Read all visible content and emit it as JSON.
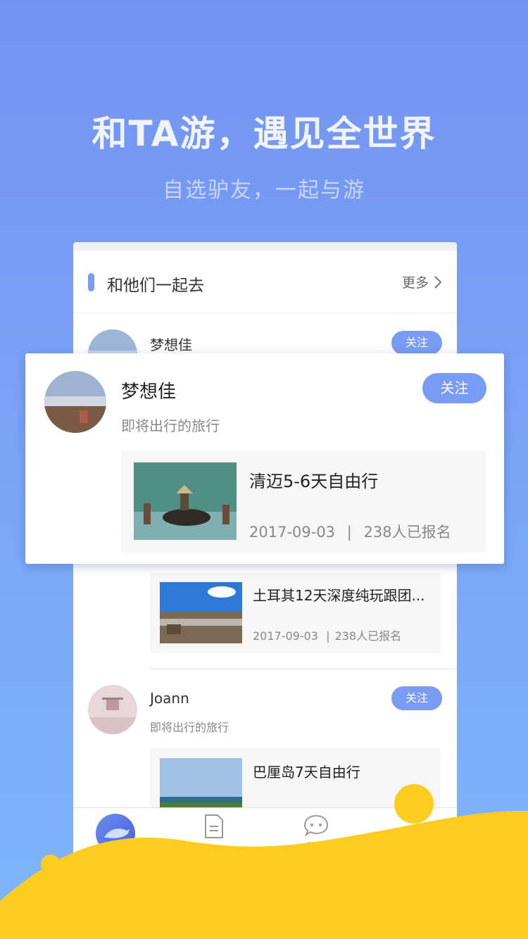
{
  "hero": {
    "title": "和TA游，遇见全世界",
    "subtitle": "自选驴友，一起与游"
  },
  "section": {
    "title": "和他们一起去",
    "more_label": "更多"
  },
  "list": {
    "item1": {
      "name": "梦想佳",
      "follow_label": "关注",
      "trip": {
        "title": "土耳其12天深度纯玩跟团...",
        "date": "2017-09-03",
        "separator": "|",
        "signups": "238人已报名"
      }
    },
    "item2": {
      "name": "Joann",
      "subtitle": "即将出行的旅行",
      "follow_label": "关注",
      "trip": {
        "title": "巴厘岛7天自由行"
      }
    }
  },
  "popup": {
    "name": "梦想佳",
    "subtitle": "即将出行的旅行",
    "follow_label": "关注",
    "trip": {
      "title": "清迈5-6天自由行",
      "date": "2017-09-03",
      "separator": "|",
      "signups": "238人已报名"
    }
  },
  "tabbar": {
    "chat_label": "聊天"
  },
  "colors": {
    "accent": "#7a9bf4",
    "wave": "#fccd1e",
    "bg_top": "#7393f2",
    "bg_bottom": "#7eb6fb"
  },
  "icons": {
    "more": "chevron-right-icon",
    "tab_home": "dolphin-icon",
    "tab_doc": "document-icon",
    "tab_chat": "chat-bubble-icon"
  }
}
